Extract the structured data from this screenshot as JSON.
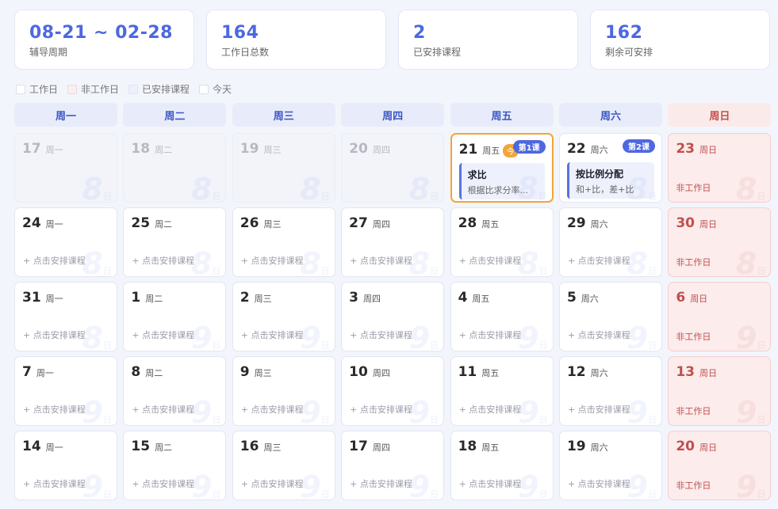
{
  "stats": [
    {
      "value": "08-21 ~ 02-28",
      "label": "辅导周期"
    },
    {
      "value": "164",
      "label": "工作日总数"
    },
    {
      "value": "2",
      "label": "已安排课程"
    },
    {
      "value": "162",
      "label": "剩余可安排"
    }
  ],
  "legend": [
    "工作日",
    "非工作日",
    "已安排课程",
    "今天"
  ],
  "weekdays": [
    "周一",
    "周二",
    "周三",
    "周四",
    "周五",
    "周六",
    "周日"
  ],
  "add_hint": "+ 点击安排课程",
  "nonwork_label": "非工作日",
  "today_badge": "今",
  "watermark_unit": "日",
  "days": [
    {
      "num": "17",
      "wk": "周一",
      "state": "disabled",
      "wm": "8"
    },
    {
      "num": "18",
      "wk": "周二",
      "state": "disabled",
      "wm": "8"
    },
    {
      "num": "19",
      "wk": "周三",
      "state": "disabled",
      "wm": "8"
    },
    {
      "num": "20",
      "wk": "周四",
      "state": "disabled",
      "wm": "8"
    },
    {
      "num": "21",
      "wk": "周五",
      "state": "today",
      "wm": "8",
      "course": {
        "badge": "第1课",
        "title": "求比",
        "sub": "根据比求分率..."
      }
    },
    {
      "num": "22",
      "wk": "周六",
      "state": "work",
      "wm": "8",
      "course": {
        "badge": "第2课",
        "title": "按比例分配",
        "sub": "和+比，差+比"
      }
    },
    {
      "num": "23",
      "wk": "周日",
      "state": "nonwork",
      "wm": "8"
    },
    {
      "num": "24",
      "wk": "周一",
      "state": "work",
      "wm": "8"
    },
    {
      "num": "25",
      "wk": "周二",
      "state": "work",
      "wm": "8"
    },
    {
      "num": "26",
      "wk": "周三",
      "state": "work",
      "wm": "8"
    },
    {
      "num": "27",
      "wk": "周四",
      "state": "work",
      "wm": "8"
    },
    {
      "num": "28",
      "wk": "周五",
      "state": "work",
      "wm": "8"
    },
    {
      "num": "29",
      "wk": "周六",
      "state": "work",
      "wm": "8"
    },
    {
      "num": "30",
      "wk": "周日",
      "state": "nonwork",
      "wm": "8"
    },
    {
      "num": "31",
      "wk": "周一",
      "state": "work",
      "wm": "8"
    },
    {
      "num": "1",
      "wk": "周二",
      "state": "work",
      "wm": "9"
    },
    {
      "num": "2",
      "wk": "周三",
      "state": "work",
      "wm": "9"
    },
    {
      "num": "3",
      "wk": "周四",
      "state": "work",
      "wm": "9"
    },
    {
      "num": "4",
      "wk": "周五",
      "state": "work",
      "wm": "9"
    },
    {
      "num": "5",
      "wk": "周六",
      "state": "work",
      "wm": "9"
    },
    {
      "num": "6",
      "wk": "周日",
      "state": "nonwork",
      "wm": "9"
    },
    {
      "num": "7",
      "wk": "周一",
      "state": "work",
      "wm": "9"
    },
    {
      "num": "8",
      "wk": "周二",
      "state": "work",
      "wm": "9"
    },
    {
      "num": "9",
      "wk": "周三",
      "state": "work",
      "wm": "9"
    },
    {
      "num": "10",
      "wk": "周四",
      "state": "work",
      "wm": "9"
    },
    {
      "num": "11",
      "wk": "周五",
      "state": "work",
      "wm": "9"
    },
    {
      "num": "12",
      "wk": "周六",
      "state": "work",
      "wm": "9"
    },
    {
      "num": "13",
      "wk": "周日",
      "state": "nonwork",
      "wm": "9"
    },
    {
      "num": "14",
      "wk": "周一",
      "state": "work",
      "wm": "9"
    },
    {
      "num": "15",
      "wk": "周二",
      "state": "work",
      "wm": "9"
    },
    {
      "num": "16",
      "wk": "周三",
      "state": "work",
      "wm": "9"
    },
    {
      "num": "17",
      "wk": "周四",
      "state": "work",
      "wm": "9"
    },
    {
      "num": "18",
      "wk": "周五",
      "state": "work",
      "wm": "9"
    },
    {
      "num": "19",
      "wk": "周六",
      "state": "work",
      "wm": "9"
    },
    {
      "num": "20",
      "wk": "周日",
      "state": "nonwork",
      "wm": "9"
    }
  ]
}
